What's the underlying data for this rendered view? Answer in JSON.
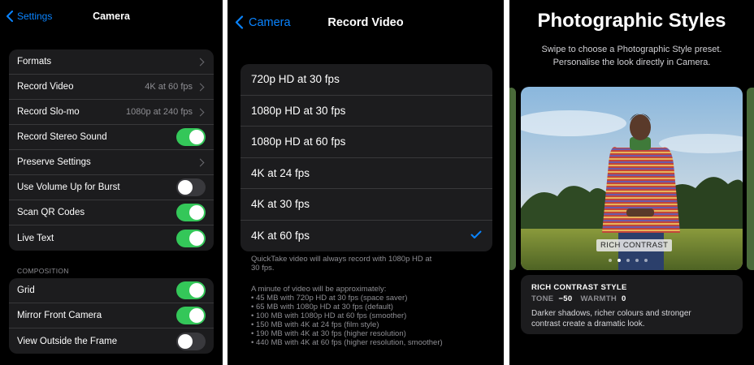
{
  "settings": {
    "back_label": "Settings",
    "title": "Camera",
    "rows": [
      {
        "label": "Formats",
        "value": "",
        "control": "chevron"
      },
      {
        "label": "Record Video",
        "value": "4K at 60 fps",
        "control": "chevron"
      },
      {
        "label": "Record Slo-mo",
        "value": "1080p at 240 fps",
        "control": "chevron"
      },
      {
        "label": "Record Stereo Sound",
        "value": "",
        "control": "toggle",
        "on": true
      },
      {
        "label": "Preserve Settings",
        "value": "",
        "control": "chevron"
      },
      {
        "label": "Use Volume Up for Burst",
        "value": "",
        "control": "toggle",
        "on": false
      },
      {
        "label": "Scan QR Codes",
        "value": "",
        "control": "toggle",
        "on": true
      },
      {
        "label": "Live Text",
        "value": "",
        "control": "toggle",
        "on": true
      }
    ],
    "composition_header": "COMPOSITION",
    "composition_rows": [
      {
        "label": "Grid",
        "control": "toggle",
        "on": true
      },
      {
        "label": "Mirror Front Camera",
        "control": "toggle",
        "on": true
      },
      {
        "label": "View Outside the Frame",
        "control": "toggle",
        "on": false
      }
    ]
  },
  "record_video": {
    "back_label": "Camera",
    "title": "Record Video",
    "options": [
      {
        "label": "720p HD at 30 fps",
        "selected": false
      },
      {
        "label": "1080p HD at 30 fps",
        "selected": false
      },
      {
        "label": "1080p HD at 60 fps",
        "selected": false
      },
      {
        "label": "4K at 24 fps",
        "selected": false
      },
      {
        "label": "4K at 30 fps",
        "selected": false
      },
      {
        "label": "4K at 60 fps",
        "selected": true
      }
    ],
    "quicktake_note": [
      "QuickTake video will always record with 1080p HD at",
      "30 fps."
    ],
    "size_intro": "A minute of video will be approximately:",
    "size_list": [
      "• 45 MB with 720p HD at 30 fps (space saver)",
      "• 65 MB with 1080p HD at 30 fps (default)",
      "• 100 MB with 1080p HD at 60 fps (smoother)",
      "• 150 MB with 4K at 24 fps (film style)",
      "• 190 MB with 4K at 30 fps (higher resolution)",
      "• 440 MB with 4K at 60 fps (higher resolution, smoother)"
    ]
  },
  "styles": {
    "title": "Photographic Styles",
    "subtitle_lines": [
      "Swipe to choose a Photographic Style preset.",
      "Personalise the look directly in Camera."
    ],
    "photo_label": "RICH CONTRAST",
    "page_count": 5,
    "active_page": 1,
    "style_name": "RICH CONTRAST STYLE",
    "tone_label": "TONE",
    "tone_value": "−50",
    "warmth_label": "WARMTH",
    "warmth_value": "0",
    "description_lines": [
      "Darker shadows, richer colours and stronger",
      "contrast create a dramatic look."
    ]
  },
  "colors": {
    "accent": "#0a84ff",
    "toggle_on": "#34c759",
    "cell_background": "#1c1c1e"
  }
}
